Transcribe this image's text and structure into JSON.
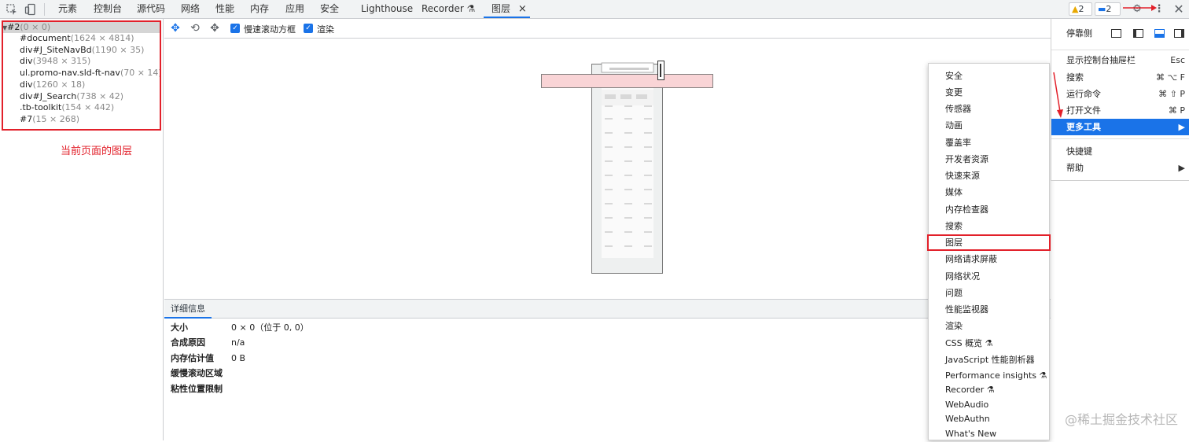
{
  "topbar": {
    "tabs": [
      "元素",
      "控制台",
      "源代码",
      "网络",
      "性能",
      "内存",
      "应用",
      "安全",
      "Lighthouse",
      "Recorder ⚗",
      "图层"
    ],
    "close_symbol": "×",
    "warnings_count": "2",
    "messages_count": "2",
    "colors": {
      "accent": "#1a73e8",
      "annotation": "#e2202a"
    }
  },
  "layers_tree": {
    "items": [
      {
        "name": "#2",
        "dim": "(0 × 0)"
      },
      {
        "name": "#document",
        "dim": "(1624 × 4814)"
      },
      {
        "name": "div#J_SiteNavBd",
        "dim": "(1190 × 35)"
      },
      {
        "name": "div",
        "dim": "(3948 × 315)"
      },
      {
        "name": "ul.promo-nav.sld-ft-nav",
        "dim": "(70 × 14)"
      },
      {
        "name": "div",
        "dim": "(1260 × 18)"
      },
      {
        "name": "div#J_Search",
        "dim": "(738 × 42)"
      },
      {
        "name": ".tb-toolkit",
        "dim": "(154 × 442)"
      },
      {
        "name": "#7",
        "dim": "(15 × 268)"
      }
    ],
    "annotation": "当前页面的图层"
  },
  "layers_toolbar": {
    "slow_scroll_label": "慢速滚动方框",
    "paint_label": "渲染"
  },
  "details": {
    "tab": "详细信息",
    "rows": [
      {
        "key": "大小",
        "value": "0 × 0（位于 0, 0）"
      },
      {
        "key": "合成原因",
        "value": "n/a"
      },
      {
        "key": "内存估计值",
        "value": "0 B"
      },
      {
        "key": "缓慢滚动区域",
        "value": ""
      },
      {
        "key": "粘性位置限制",
        "value": ""
      }
    ]
  },
  "more_tools_menu": {
    "items": [
      "安全",
      "变更",
      "传感器",
      "动画",
      "覆盖率",
      "开发者资源",
      "快速来源",
      "媒体",
      "内存检查器",
      "搜索",
      "图层",
      "网络请求屏蔽",
      "网络状况",
      "问题",
      "性能监视器",
      "渲染",
      "CSS 概览 ⚗",
      "JavaScript 性能剖析器",
      "Performance insights ⚗",
      "Recorder ⚗",
      "WebAudio",
      "WebAuthn",
      "What's New"
    ]
  },
  "main_menu": {
    "dock_label": "停靠侧",
    "items": [
      {
        "label": "显示控制台抽屉栏",
        "shortcut": "Esc"
      },
      {
        "label": "搜索",
        "shortcut": "⌘ ⌥ F"
      },
      {
        "label": "运行命令",
        "shortcut": "⌘ ⇧ P"
      },
      {
        "label": "打开文件",
        "shortcut": "⌘ P"
      },
      {
        "label": "更多工具",
        "shortcut": "▶"
      },
      {
        "label": "快捷键",
        "shortcut": ""
      },
      {
        "label": "帮助",
        "shortcut": "▶"
      }
    ]
  },
  "watermark": "@稀土掘金技术社区"
}
